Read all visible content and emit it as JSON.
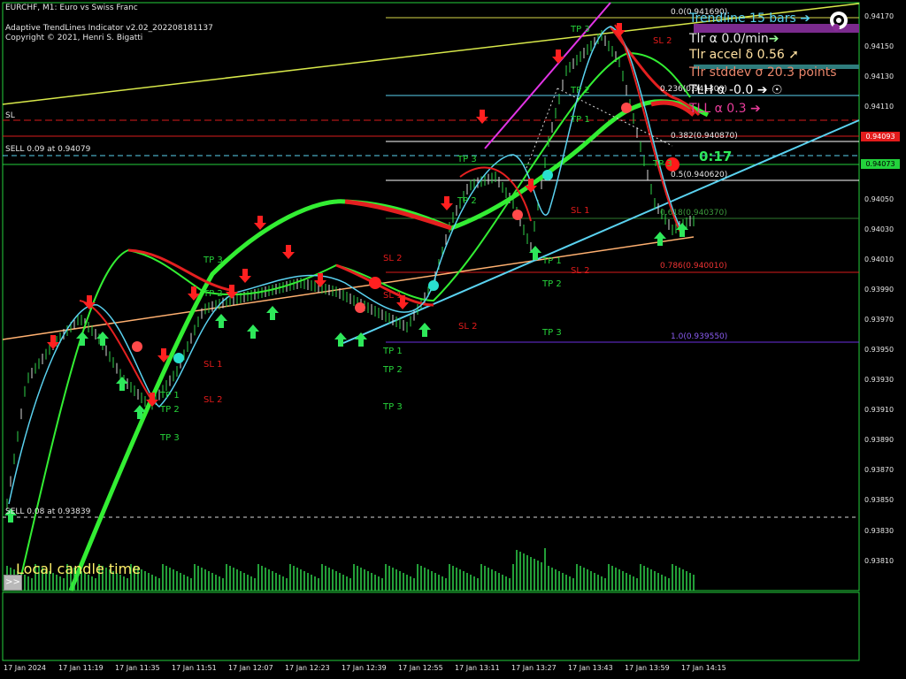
{
  "header": {
    "symbol_line": "EURCHF, M1:  Euro vs Swiss Franc",
    "indicator_line": "Adaptive TrendLines Indicator v2.02_202208181137",
    "copyright_line": "Copyright © 2021, Henri S. Bigatti"
  },
  "colors": {
    "background": "#000000",
    "frame": "#23d13c",
    "up_arrow": "#2ee85a",
    "down_arrow": "#ff2020",
    "trendline_cyan": "#5ad2f0",
    "trendline_magenta": "#e234e6",
    "ma_green": "#33ee33",
    "ma_red": "#e42020"
  },
  "price_axis": {
    "labels": [
      "0.94170",
      "0.94150",
      "0.94130",
      "0.94110",
      "0.94093",
      "0.94073",
      "0.94050",
      "0.94030",
      "0.94010",
      "0.93990",
      "0.93970",
      "0.93950",
      "0.93930",
      "0.93910",
      "0.93890",
      "0.93870",
      "0.93850",
      "0.93830",
      "0.93810"
    ],
    "current_price_red": "0.94093",
    "current_price_green": "0.94073"
  },
  "time_axis": {
    "labels": [
      "17 Jan 2024",
      "17 Jan 11:19",
      "17 Jan 11:35",
      "17 Jan 11:51",
      "17 Jan 12:07",
      "17 Jan 12:23",
      "17 Jan 12:39",
      "17 Jan 12:55",
      "17 Jan 13:11",
      "17 Jan 13:27",
      "17 Jan 13:43",
      "17 Jan 13:59",
      "17 Jan 14:15"
    ]
  },
  "orders": {
    "sl_label": "SL",
    "sell_label": "SELL 0.09 at 0.94079",
    "sell2_label": "SELL 0.08 at 0.93839"
  },
  "fibonacci": {
    "levels": [
      "0.0(0.941690)",
      "0.236(0.941300)",
      "0.382(0.940870)",
      "0.5(0.940620)",
      "0.618(0.940370)",
      "0.786(0.940010)",
      "1.0(0.939550)"
    ]
  },
  "panel": {
    "trendline": "Trendline 15 bars",
    "tlr_alpha": "Tlr α 0.0/min",
    "tlr_accel": "Tlr accel δ 0.56",
    "tlr_stddev": "Tlr stddev σ 20.3 points",
    "tlh_alpha": "TLH α -0.0",
    "tll_alpha": "TLL α 0.3",
    "timer": "0:17"
  },
  "tp_sl_labels": {
    "tp1": "TP 1",
    "tp2": "TP 2",
    "tp3": "TP 3",
    "sl1": "SL 1",
    "sl2": "SL 2"
  },
  "footer": {
    "local_time_label": "Local candle time",
    "expand_button": ">>"
  }
}
